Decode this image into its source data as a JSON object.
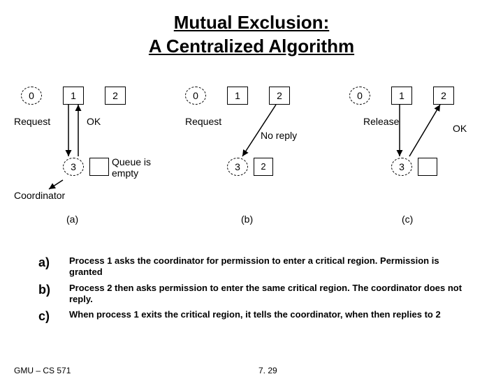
{
  "title_line1": "Mutual Exclusion:",
  "title_line2": "A Centralized Algorithm",
  "panels": {
    "a": {
      "n0": "0",
      "n1": "1",
      "n2": "2",
      "n3": "3",
      "req": "Request",
      "ok": "OK",
      "queue_label": "Queue is\nempty",
      "coord": "Coordinator",
      "caption": "(a)"
    },
    "b": {
      "n0": "0",
      "n1": "1",
      "n2": "2",
      "n3": "3",
      "req": "Request",
      "noreply": "No reply",
      "queue_val": "2",
      "caption": "(b)"
    },
    "c": {
      "n0": "0",
      "n1": "1",
      "n2": "2",
      "n3": "3",
      "rel": "Release",
      "ok": "OK",
      "caption": "(c)"
    }
  },
  "notes": {
    "a": {
      "key": "a)",
      "text": "Process 1 asks the coordinator for permission to enter a critical region. Permission is granted"
    },
    "b": {
      "key": "b)",
      "text": "Process 2 then asks permission to enter the same critical region.  The coordinator does not reply."
    },
    "c": {
      "key": "c)",
      "text": "When process 1 exits the critical region, it tells the coordinator, when then replies to 2"
    }
  },
  "footer": {
    "left": "GMU – CS 571",
    "page": "7. 29"
  }
}
